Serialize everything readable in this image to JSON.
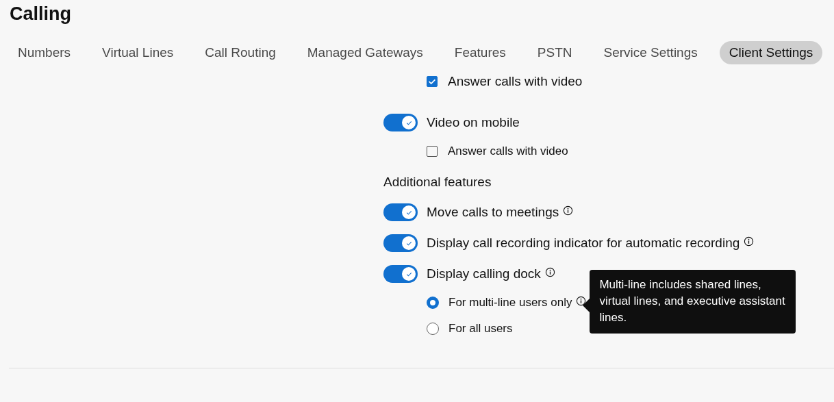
{
  "page": {
    "title": "Calling"
  },
  "tabs": [
    {
      "label": "Numbers",
      "selected": false
    },
    {
      "label": "Virtual Lines",
      "selected": false
    },
    {
      "label": "Call Routing",
      "selected": false
    },
    {
      "label": "Managed Gateways",
      "selected": false
    },
    {
      "label": "Features",
      "selected": false
    },
    {
      "label": "PSTN",
      "selected": false
    },
    {
      "label": "Service Settings",
      "selected": false
    },
    {
      "label": "Client Settings",
      "selected": true
    }
  ],
  "cut_off_row": {
    "label": "Answer calls with video",
    "checked": true
  },
  "settings": [
    {
      "kind": "toggle",
      "label": "Video on mobile",
      "on": true,
      "info": false,
      "children": [
        {
          "kind": "checkbox",
          "label": "Answer calls with video",
          "checked": false,
          "info": false
        }
      ]
    },
    {
      "kind": "heading",
      "label": "Additional features"
    },
    {
      "kind": "toggle",
      "label": "Move calls to meetings",
      "on": true,
      "info": true
    },
    {
      "kind": "toggle",
      "label": "Display call recording indicator for automatic recording",
      "on": true,
      "info": true
    },
    {
      "kind": "toggle",
      "label": "Display calling dock",
      "on": true,
      "info": true,
      "children": [
        {
          "kind": "radio",
          "label": "For multi-line users only",
          "selected": true,
          "info": true,
          "tooltip": "Multi-line includes shared lines, virtual lines, and executive assistant lines."
        },
        {
          "kind": "radio",
          "label": "For all users",
          "selected": false,
          "info": false
        }
      ]
    }
  ]
}
